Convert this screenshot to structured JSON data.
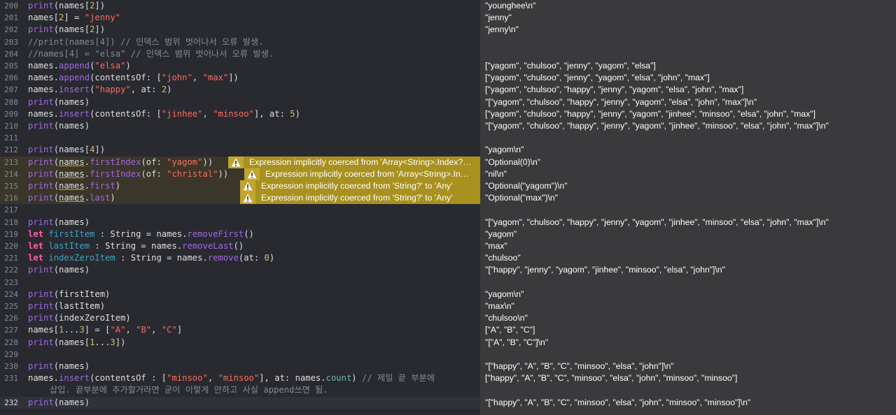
{
  "editor": {
    "lines": [
      {
        "n": "200",
        "top": 0,
        "tokens": [
          [
            "fn",
            "print"
          ],
          [
            "plain",
            "(names["
          ],
          [
            "num",
            "2"
          ],
          [
            "plain",
            "])"
          ]
        ]
      },
      {
        "n": "201",
        "tokens": [
          [
            "plain",
            "names["
          ],
          [
            "num",
            "2"
          ],
          [
            "plain",
            "] = "
          ],
          [
            "str",
            "\"jenny\""
          ]
        ]
      },
      {
        "n": "202",
        "tokens": [
          [
            "fn",
            "print"
          ],
          [
            "plain",
            "(names["
          ],
          [
            "num",
            "2"
          ],
          [
            "plain",
            "])"
          ]
        ]
      },
      {
        "n": "203",
        "tokens": [
          [
            "com",
            "//print(names[4]) // 인덱스 범위 벗어나서 오류 발생."
          ]
        ]
      },
      {
        "n": "204",
        "tokens": [
          [
            "com",
            "//names[4] = \"elsa\" // 인덱스 범위 벗어나서 오류 발생."
          ]
        ]
      },
      {
        "n": "205",
        "tokens": [
          [
            "plain",
            "names."
          ],
          [
            "fn",
            "append"
          ],
          [
            "plain",
            "("
          ],
          [
            "str",
            "\"elsa\""
          ],
          [
            "plain",
            ")"
          ]
        ]
      },
      {
        "n": "206",
        "tokens": [
          [
            "plain",
            "names."
          ],
          [
            "fn",
            "append"
          ],
          [
            "plain",
            "(contentsOf: ["
          ],
          [
            "str",
            "\"john\""
          ],
          [
            "plain",
            ", "
          ],
          [
            "str",
            "\"max\""
          ],
          [
            "plain",
            "])"
          ]
        ]
      },
      {
        "n": "207",
        "tokens": [
          [
            "plain",
            "names."
          ],
          [
            "fn",
            "insert"
          ],
          [
            "plain",
            "("
          ],
          [
            "str",
            "\"happy\""
          ],
          [
            "plain",
            ", at: "
          ],
          [
            "num",
            "2"
          ],
          [
            "plain",
            ")"
          ]
        ]
      },
      {
        "n": "208",
        "tokens": [
          [
            "fn",
            "print"
          ],
          [
            "plain",
            "(names)"
          ]
        ]
      },
      {
        "n": "209",
        "tokens": [
          [
            "plain",
            "names."
          ],
          [
            "fn",
            "insert"
          ],
          [
            "plain",
            "(contentsOf: ["
          ],
          [
            "str",
            "\"jinhee\""
          ],
          [
            "plain",
            ", "
          ],
          [
            "str",
            "\"minsoo\""
          ],
          [
            "plain",
            "], at: "
          ],
          [
            "num",
            "5"
          ],
          [
            "plain",
            ")"
          ]
        ]
      },
      {
        "n": "210",
        "tokens": [
          [
            "fn",
            "print"
          ],
          [
            "plain",
            "(names)"
          ]
        ]
      },
      {
        "n": "211",
        "tokens": []
      },
      {
        "n": "212",
        "tokens": [
          [
            "fn",
            "print"
          ],
          [
            "plain",
            "(names["
          ],
          [
            "num",
            "4"
          ],
          [
            "plain",
            "])"
          ]
        ]
      },
      {
        "n": "213",
        "warn": true,
        "tokens": [
          [
            "fn",
            "print"
          ],
          [
            "plain",
            "("
          ],
          [
            "u",
            "names"
          ],
          [
            "plain",
            "."
          ],
          [
            "fn",
            "firstIndex"
          ],
          [
            "plain",
            "(of: "
          ],
          [
            "str",
            "\"yagom\""
          ],
          [
            "plain",
            "))"
          ]
        ]
      },
      {
        "n": "214",
        "warn": true,
        "tokens": [
          [
            "fn",
            "print"
          ],
          [
            "plain",
            "("
          ],
          [
            "u",
            "names"
          ],
          [
            "plain",
            "."
          ],
          [
            "fn",
            "firstIndex"
          ],
          [
            "plain",
            "(of: "
          ],
          [
            "str",
            "\"christal\""
          ],
          [
            "plain",
            "))"
          ]
        ]
      },
      {
        "n": "215",
        "warn": true,
        "tokens": [
          [
            "fn",
            "print"
          ],
          [
            "plain",
            "("
          ],
          [
            "u",
            "names"
          ],
          [
            "plain",
            "."
          ],
          [
            "fn",
            "first"
          ],
          [
            "plain",
            ")"
          ]
        ]
      },
      {
        "n": "216",
        "warn": true,
        "tokens": [
          [
            "fn",
            "print"
          ],
          [
            "plain",
            "("
          ],
          [
            "u",
            "names"
          ],
          [
            "plain",
            "."
          ],
          [
            "fn",
            "last"
          ],
          [
            "plain",
            ")"
          ]
        ]
      },
      {
        "n": "217",
        "tokens": []
      },
      {
        "n": "218",
        "tokens": [
          [
            "fn",
            "print"
          ],
          [
            "plain",
            "(names)"
          ]
        ]
      },
      {
        "n": "219",
        "tokens": [
          [
            "kw",
            "let"
          ],
          [
            "plain",
            " "
          ],
          [
            "decl",
            "firstItem"
          ],
          [
            "plain",
            " : String = names."
          ],
          [
            "fn",
            "removeFirst"
          ],
          [
            "plain",
            "()"
          ]
        ]
      },
      {
        "n": "220",
        "tokens": [
          [
            "kw",
            "let"
          ],
          [
            "plain",
            " "
          ],
          [
            "decl",
            "lastItem"
          ],
          [
            "plain",
            " : String = names."
          ],
          [
            "fn",
            "removeLast"
          ],
          [
            "plain",
            "()"
          ]
        ]
      },
      {
        "n": "221",
        "tokens": [
          [
            "kw",
            "let"
          ],
          [
            "plain",
            " "
          ],
          [
            "decl",
            "indexZeroItem"
          ],
          [
            "plain",
            " : String = names."
          ],
          [
            "fn",
            "remove"
          ],
          [
            "plain",
            "(at: "
          ],
          [
            "num",
            "0"
          ],
          [
            "plain",
            ")"
          ]
        ]
      },
      {
        "n": "222",
        "tokens": [
          [
            "fn",
            "print"
          ],
          [
            "plain",
            "(names)"
          ]
        ]
      },
      {
        "n": "223",
        "tokens": []
      },
      {
        "n": "224",
        "tokens": [
          [
            "fn",
            "print"
          ],
          [
            "plain",
            "(firstItem)"
          ]
        ]
      },
      {
        "n": "225",
        "tokens": [
          [
            "fn",
            "print"
          ],
          [
            "plain",
            "(lastItem)"
          ]
        ]
      },
      {
        "n": "226",
        "tokens": [
          [
            "fn",
            "print"
          ],
          [
            "plain",
            "(indexZeroItem)"
          ]
        ]
      },
      {
        "n": "227",
        "tokens": [
          [
            "plain",
            "names["
          ],
          [
            "num",
            "1"
          ],
          [
            "plain",
            "..."
          ],
          [
            "num",
            "3"
          ],
          [
            "plain",
            "] = ["
          ],
          [
            "str",
            "\"A\""
          ],
          [
            "plain",
            ", "
          ],
          [
            "str",
            "\"B\""
          ],
          [
            "plain",
            ", "
          ],
          [
            "str",
            "\"C\""
          ],
          [
            "plain",
            "]"
          ]
        ]
      },
      {
        "n": "228",
        "tokens": [
          [
            "fn",
            "print"
          ],
          [
            "plain",
            "(names["
          ],
          [
            "num",
            "1"
          ],
          [
            "plain",
            "..."
          ],
          [
            "num",
            "3"
          ],
          [
            "plain",
            "])"
          ]
        ]
      },
      {
        "n": "229",
        "tokens": []
      },
      {
        "n": "230",
        "tokens": [
          [
            "fn",
            "print"
          ],
          [
            "plain",
            "(names)"
          ]
        ]
      },
      {
        "n": "231",
        "tokens": [
          [
            "plain",
            "names."
          ],
          [
            "fn",
            "insert"
          ],
          [
            "plain",
            "(contentsOf : ["
          ],
          [
            "str",
            "\"minsoo\""
          ],
          [
            "plain",
            ", "
          ],
          [
            "str",
            "\"minsoo\""
          ],
          [
            "plain",
            "], at: names."
          ],
          [
            "prop",
            "count"
          ],
          [
            "plain",
            ") "
          ],
          [
            "com",
            "// 제일 끝 부분에"
          ]
        ]
      },
      {
        "n": "",
        "wrap": true,
        "tokens": [
          [
            "com",
            "삽입. 끝부분에 추가할거라면 굳이 이렇게 안하고 사실 append쓰면 됨."
          ]
        ]
      },
      {
        "n": "232",
        "cur": true,
        "tokens": [
          [
            "fn",
            "print"
          ],
          [
            "plain",
            "(names)"
          ]
        ]
      }
    ],
    "warnings": [
      {
        "line": 13,
        "text": "Expression implicitly coerced from 'Array<String>.Index?…"
      },
      {
        "line": 14,
        "text": "Expression implicitly coerced from 'Array<String>.In…"
      },
      {
        "line": 15,
        "text": "Expression implicitly coerced from 'String?' to 'Any'"
      },
      {
        "line": 16,
        "text": "Expression implicitly coerced from 'String?' to 'Any'"
      }
    ],
    "warning_icon": "warning-triangle-icon",
    "colors": {
      "warning_badge": "#a8911f",
      "background": "#292a30",
      "results_background": "#3a3a3c"
    }
  },
  "results": [
    {
      "line": 0,
      "text": "\"younghee\\n\""
    },
    {
      "line": 1,
      "text": "\"jenny\""
    },
    {
      "line": 2,
      "text": "\"jenny\\n\""
    },
    {
      "line": 5,
      "text": "[\"yagom\", \"chulsoo\", \"jenny\", \"yagom\", \"elsa\"]"
    },
    {
      "line": 6,
      "text": "[\"yagom\", \"chulsoo\", \"jenny\", \"yagom\", \"elsa\", \"john\", \"max\"]"
    },
    {
      "line": 7,
      "text": "[\"yagom\", \"chulsoo\", \"happy\", \"jenny\", \"yagom\", \"elsa\", \"john\", \"max\"]"
    },
    {
      "line": 8,
      "text": "\"[\"yagom\", \"chulsoo\", \"happy\", \"jenny\", \"yagom\", \"elsa\", \"john\", \"max\"]\\n\""
    },
    {
      "line": 9,
      "text": "[\"yagom\", \"chulsoo\", \"happy\", \"jenny\", \"yagom\", \"jinhee\", \"minsoo\", \"elsa\", \"john\", \"max\"]"
    },
    {
      "line": 10,
      "text": "\"[\"yagom\", \"chulsoo\", \"happy\", \"jenny\", \"yagom\", \"jinhee\", \"minsoo\", \"elsa\", \"john\", \"max\"]\\n\""
    },
    {
      "line": 12,
      "text": "\"yagom\\n\""
    },
    {
      "line": 13,
      "text": "\"Optional(0)\\n\""
    },
    {
      "line": 14,
      "text": "\"nil\\n\""
    },
    {
      "line": 15,
      "text": "\"Optional(\"yagom\")\\n\""
    },
    {
      "line": 16,
      "text": "\"Optional(\"max\")\\n\""
    },
    {
      "line": 18,
      "text": "\"[\"yagom\", \"chulsoo\", \"happy\", \"jenny\", \"yagom\", \"jinhee\", \"minsoo\", \"elsa\", \"john\", \"max\"]\\n\""
    },
    {
      "line": 19,
      "text": "\"yagom\""
    },
    {
      "line": 20,
      "text": "\"max\""
    },
    {
      "line": 21,
      "text": "\"chulsoo\""
    },
    {
      "line": 22,
      "text": "\"[\"happy\", \"jenny\", \"yagom\", \"jinhee\", \"minsoo\", \"elsa\", \"john\"]\\n\""
    },
    {
      "line": 24,
      "text": "\"yagom\\n\""
    },
    {
      "line": 25,
      "text": "\"max\\n\""
    },
    {
      "line": 26,
      "text": "\"chulsoo\\n\""
    },
    {
      "line": 27,
      "text": "[\"A\", \"B\", \"C\"]"
    },
    {
      "line": 28,
      "text": "\"[\"A\", \"B\", \"C\"]\\n\""
    },
    {
      "line": 30,
      "text": "\"[\"happy\", \"A\", \"B\", \"C\", \"minsoo\", \"elsa\", \"john\"]\\n\""
    },
    {
      "line": 31,
      "text": "[\"happy\", \"A\", \"B\", \"C\", \"minsoo\", \"elsa\", \"john\", \"minsoo\", \"minsoo\"]"
    },
    {
      "line": 33,
      "text": "\"[\"happy\", \"A\", \"B\", \"C\", \"minsoo\", \"elsa\", \"john\", \"minsoo\", \"minsoo\"]\\n\""
    }
  ]
}
